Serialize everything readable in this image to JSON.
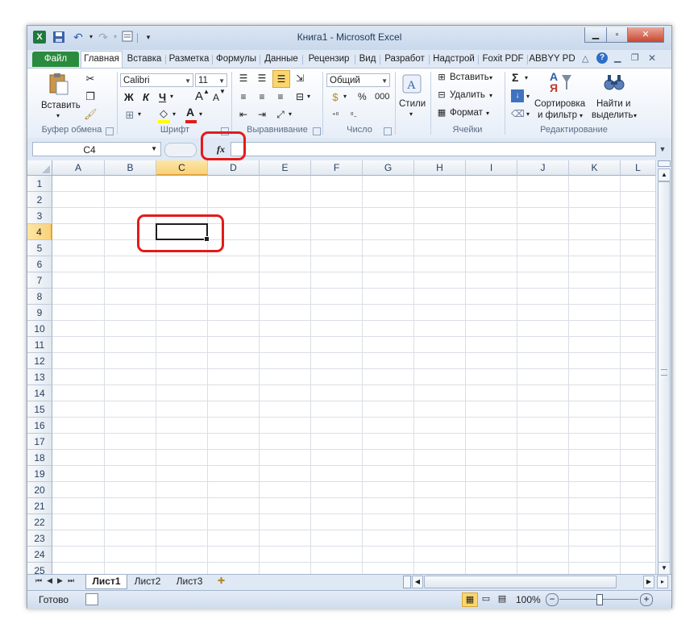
{
  "window": {
    "title": "Книга1 - Microsoft Excel"
  },
  "tabs": [
    "Файл",
    "Главная",
    "Вставка",
    "Разметка",
    "Формулы",
    "Данные",
    "Рецензир",
    "Вид",
    "Разработ",
    "Надстрой",
    "Foxit PDF",
    "ABBYY PD"
  ],
  "ribbon": {
    "clipboard": {
      "paste": "Вставить",
      "label": "Буфер обмена"
    },
    "font": {
      "name": "Calibri",
      "size": "11",
      "bold": "Ж",
      "italic": "К",
      "underline": "Ч",
      "grow": "A",
      "shrink": "A",
      "color_letter": "A",
      "label": "Шрифт"
    },
    "alignment": {
      "label": "Выравнивание"
    },
    "number": {
      "format": "Общий",
      "percent": "%",
      "thousands": "000",
      "label": "Число"
    },
    "styles": {
      "button": "Стили"
    },
    "cells": {
      "insert": "Вставить",
      "delete": "Удалить",
      "format": "Формат",
      "label": "Ячейки"
    },
    "editing": {
      "sigma": "Σ",
      "sort_line1": "Сортировка",
      "sort_line2": "и фильтр",
      "find_line1": "Найти и",
      "find_line2": "выделить",
      "sort_icon_a": "А",
      "sort_icon_ya": "Я",
      "label": "Редактирование"
    }
  },
  "formula_bar": {
    "name_box": "C4",
    "fx": "fx",
    "value": ""
  },
  "grid": {
    "columns": [
      "A",
      "B",
      "C",
      "D",
      "E",
      "F",
      "G",
      "H",
      "I",
      "J",
      "K",
      "L"
    ],
    "rows": [
      "1",
      "2",
      "3",
      "4",
      "5",
      "6",
      "7",
      "8",
      "9",
      "10",
      "11",
      "12",
      "13",
      "14",
      "15",
      "16",
      "17",
      "18",
      "19",
      "20",
      "21",
      "22",
      "23",
      "24",
      "25"
    ],
    "selected_cell": "C4"
  },
  "sheets": [
    "Лист1",
    "Лист2",
    "Лист3"
  ],
  "active_sheet": "Лист1",
  "status": {
    "ready": "Готово",
    "zoom": "100%",
    "zoom_level": 1.0
  },
  "colors": {
    "file_tab": "#2a8a3e",
    "selection_header": "#f9d27b",
    "highlight": "#e31b1b",
    "font_color_bar": "#e31b1b",
    "fill_color_bar": "#ffff00"
  }
}
